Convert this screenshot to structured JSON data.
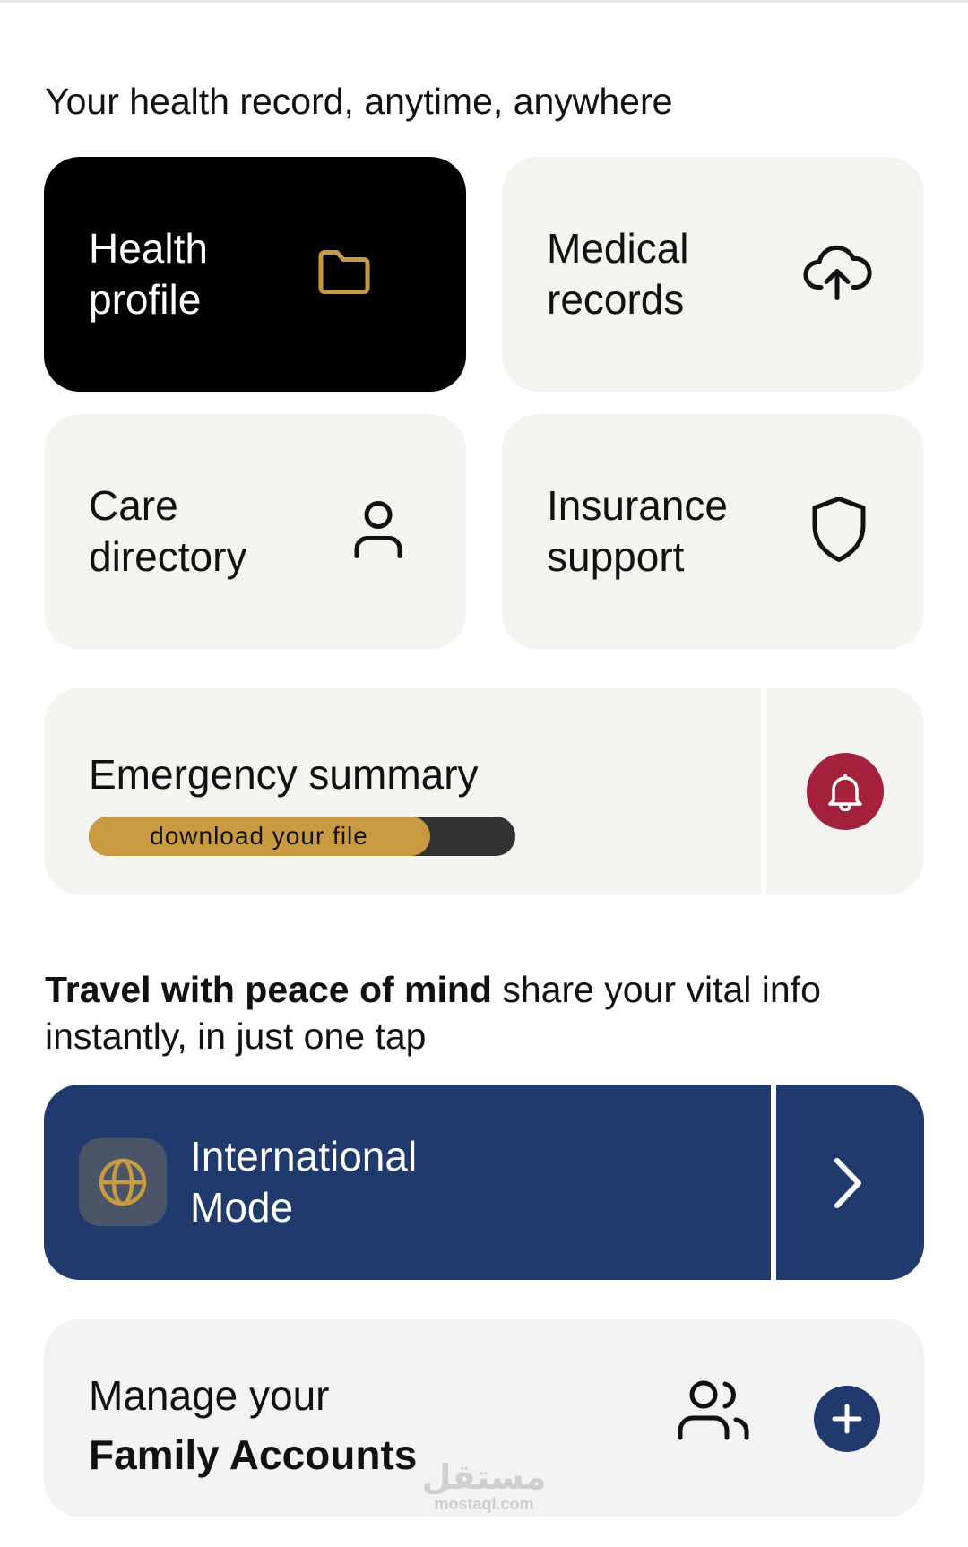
{
  "headline": "Your health record, anytime, anywhere",
  "tiles": [
    {
      "line1": "Health",
      "line2": "profile",
      "icon": "folder-icon"
    },
    {
      "line1": "Medical",
      "line2": "records",
      "icon": "cloud-upload-icon"
    },
    {
      "line1": "Care",
      "line2": "directory",
      "icon": "person-icon"
    },
    {
      "line1": "Insurance",
      "line2": "support",
      "icon": "shield-icon"
    }
  ],
  "emergency": {
    "title": "Emergency summary",
    "progress_label": "download your file",
    "progress_fraction": 0.8,
    "icon": "bell-icon"
  },
  "travel": {
    "bold": "Travel with peace of mind",
    "rest": " share your vital info instantly, in just one tap"
  },
  "international": {
    "line1": "International",
    "line2": "Mode",
    "icon": "globe-icon",
    "action_icon": "chevron-right-icon"
  },
  "family": {
    "line1": "Manage your",
    "line2": "Family Accounts",
    "icon": "users-icon",
    "action_icon": "plus-icon"
  },
  "watermark": {
    "arabic": "مستقل",
    "latin": "mostaql.com"
  },
  "colors": {
    "tile_bg": "#f6f4f0",
    "dark_tile": "#000000",
    "gold": "#c99a40",
    "alert_red": "#a3213a",
    "navy": "#213a6d"
  }
}
